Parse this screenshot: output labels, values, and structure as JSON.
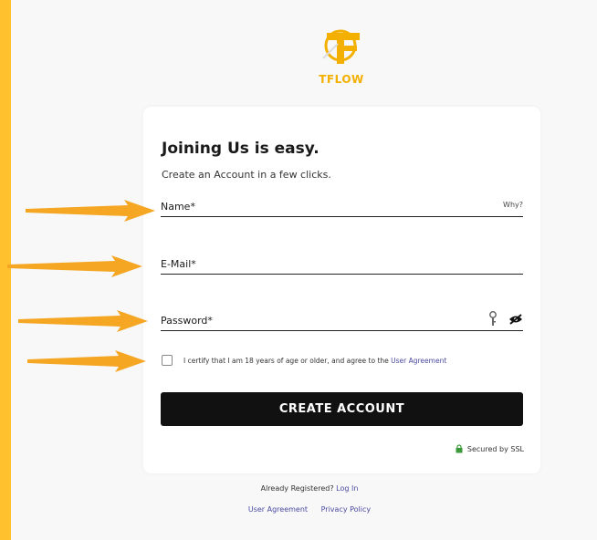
{
  "brand": {
    "name": "TFLOW",
    "accent": "#FFC12E",
    "logo_color": "#F4B000"
  },
  "heading": "Joining Us is easy.",
  "subheading": "Create an Account in a few clicks.",
  "fields": {
    "name": {
      "label": "Name*",
      "aside": "Why?"
    },
    "email": {
      "label": "E-Mail*"
    },
    "password": {
      "label": "Password*",
      "icons": [
        "key-icon",
        "eye-slash-icon"
      ]
    }
  },
  "consent": {
    "text": "I certify that I am 18 years of age or older, and agree to the",
    "link": "User Agreement",
    "checked": false
  },
  "create_button": "CREATE ACCOUNT",
  "ssl_text": "Secured by SSL",
  "footer": {
    "already_registered": "Already Registered?",
    "login_link": "Log In",
    "links": [
      "User Agreement",
      "Privacy Policy"
    ]
  },
  "annotation_arrows": {
    "color": "#F5A623",
    "count": 4
  }
}
